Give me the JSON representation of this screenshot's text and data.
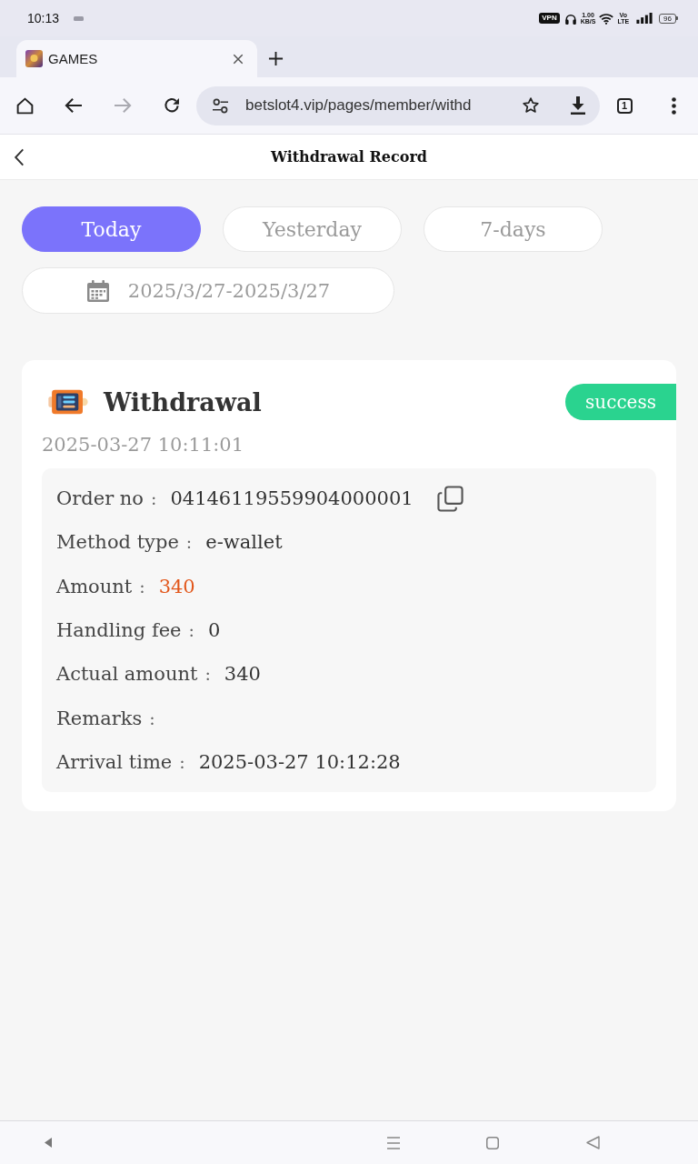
{
  "status_bar": {
    "time": "10:13",
    "vpn": "VPN",
    "speed_value": "1.00",
    "speed_unit": "KB/S",
    "volte_top": "Vo",
    "volte_bottom": "LTE",
    "battery": "96"
  },
  "browser": {
    "tabs": [
      {
        "title": "GAMES",
        "selected": true
      }
    ],
    "forward": {
      "disabled": true
    },
    "url": "betslot4.vip/pages/member/withd",
    "tab_count": "1"
  },
  "page": {
    "title": "Withdrawal Record"
  },
  "filters": [
    {
      "label": "Today",
      "selected": true
    },
    {
      "label": "Yesterday",
      "selected": false
    },
    {
      "label": "7-days",
      "selected": false
    }
  ],
  "date_range": "2025/3/27-2025/3/27",
  "records": [
    {
      "title": "Withdrawal",
      "status": {
        "label": "success",
        "kind": "success"
      },
      "time": "2025-03-27 10:11:01",
      "details": [
        {
          "label": "Order no",
          "separator": ":",
          "value": "04146119559904000001",
          "kind": "copyable"
        },
        {
          "label": "Method type",
          "separator": ":",
          "value": "e-wallet",
          "kind": "plain"
        },
        {
          "label": "Amount",
          "separator": ":",
          "value": "340",
          "kind": "amount"
        },
        {
          "label": "Handling fee",
          "separator": ":",
          "value": "0",
          "kind": "plain"
        },
        {
          "label": "Actual amount",
          "separator": ":",
          "value": "340",
          "kind": "plain"
        },
        {
          "label": "Remarks",
          "separator": ":",
          "kind": "plain"
        },
        {
          "label": "Arrival time",
          "separator": ":",
          "value": "2025-03-27 10:12:28",
          "kind": "plain"
        }
      ]
    }
  ]
}
